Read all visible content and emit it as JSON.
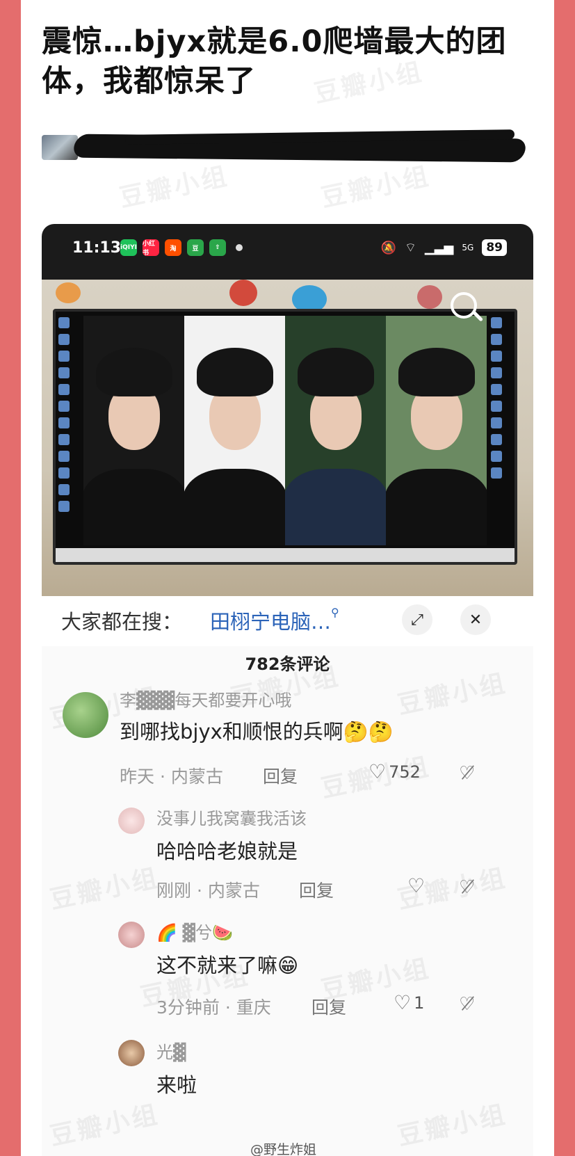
{
  "post": {
    "title": "震惊…bjyx就是6.0爬墙最大的团体，我都惊呆了"
  },
  "statusbar": {
    "time": "11:13",
    "app_icons": [
      {
        "label": "iQIYI",
        "color": "#1fc25a"
      },
      {
        "label": "小红书",
        "color": "#ff2442"
      },
      {
        "label": "淘",
        "color": "#ff5000"
      },
      {
        "label": "豆",
        "color": "#2aa64a"
      },
      {
        "label": "⇧",
        "color": "#2aa64a"
      }
    ],
    "signal": "5G",
    "battery": "89"
  },
  "search_hint": {
    "prefix": "大家都在搜：",
    "term": "田栩宁电脑…"
  },
  "comments": {
    "count_label": "782条评论",
    "items": [
      {
        "name": "李▓▓▓每天都要开心哦",
        "text": "到哪找bjyx和顺恨的兵啊🤔🤔",
        "meta": "昨天 · 内蒙古",
        "reply": "回复",
        "likes": "752"
      },
      {
        "name": "没事儿我窝囊我活该",
        "text": "哈哈哈老娘就是",
        "meta": "刚刚 · 内蒙古",
        "reply": "回复",
        "likes": ""
      },
      {
        "name": "🌈 ▓兮🍉",
        "text": "这不就来了嘛😁",
        "meta": "3分钟前 · 重庆",
        "reply": "回复",
        "likes": "1"
      },
      {
        "name": "光▓",
        "text": "来啦",
        "meta": "",
        "reply": "",
        "likes": ""
      }
    ]
  },
  "watermark": "豆瓣小组",
  "weibo_mark": "@野生炸姐",
  "colors": {
    "frame": "#e46d6d",
    "link": "#2b63b8"
  }
}
